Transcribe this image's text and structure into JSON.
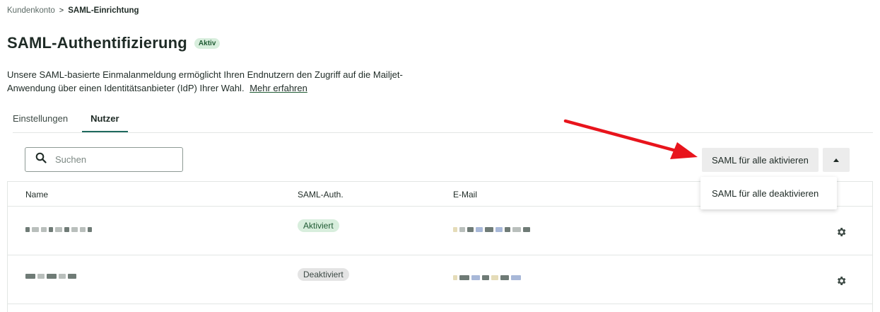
{
  "breadcrumb": {
    "parent": "Kundenkonto",
    "separator": ">",
    "current": "SAML-Einrichtung"
  },
  "header": {
    "title": "SAML-Authentifizierung",
    "status_badge": "Aktiv"
  },
  "description": {
    "text": "Unsere SAML-basierte Einmalanmeldung ermöglicht Ihren Endnutzern den Zugriff auf die Mailjet-Anwendung über einen Identitätsanbieter (IdP) Ihrer Wahl.",
    "link": "Mehr erfahren"
  },
  "tabs": [
    {
      "label": "Einstellungen",
      "active": false
    },
    {
      "label": "Nutzer",
      "active": true
    }
  ],
  "search": {
    "placeholder": "Suchen",
    "icon": "search-icon"
  },
  "actions": {
    "primary_label": "SAML für alle aktivieren",
    "toggle_icon": "triangle-up-icon",
    "dropdown_item": "SAML für alle deaktivieren"
  },
  "table": {
    "columns": [
      "Name",
      "SAML-Auth.",
      "E-Mail"
    ],
    "rows": [
      {
        "saml_status": "Aktiviert",
        "action_icon": "gear-icon"
      },
      {
        "saml_status": "Deaktiviert",
        "action_icon": "gear-icon"
      }
    ]
  },
  "colors": {
    "accent_tab": "#1f6a5e",
    "badge_active_bg": "#d8eedd",
    "badge_inactive_bg": "#e4e4e4",
    "annotation_arrow": "#e8141c"
  }
}
